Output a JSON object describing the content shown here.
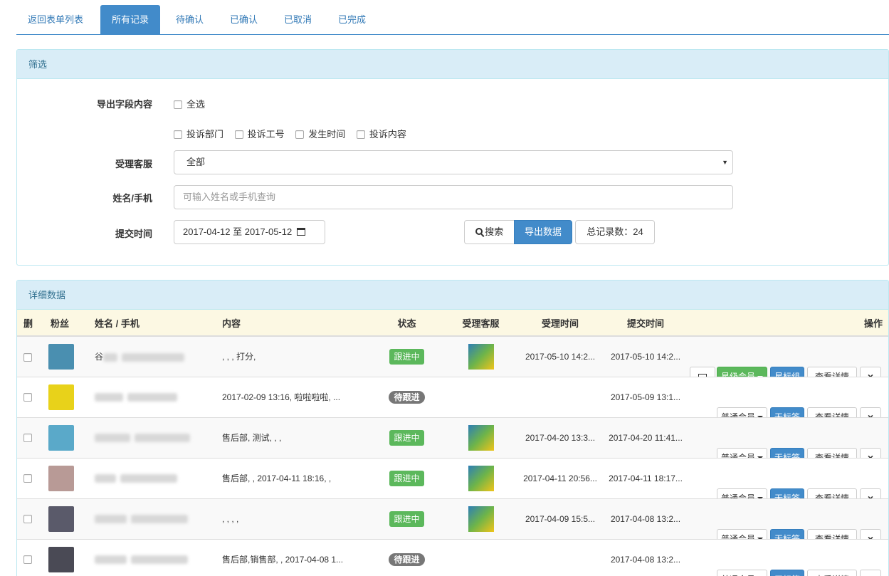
{
  "tabs": [
    "返回表单列表",
    "所有记录",
    "待确认",
    "已确认",
    "已取消",
    "已完成"
  ],
  "filter": {
    "heading": "筛选",
    "export_label": "导出字段内容",
    "select_all": "全选",
    "fields": [
      "投诉部门",
      "投诉工号",
      "发生时间",
      "投诉内容"
    ],
    "agent_label": "受理客服",
    "agent_value": "全部",
    "name_label": "姓名/手机",
    "name_placeholder": "可输入姓名或手机查询",
    "time_label": "提交时间",
    "date_range": "2017-04-12 至 2017-05-12",
    "search_btn": "搜索",
    "export_btn": "导出数据",
    "total_label": "总记录数：24"
  },
  "detail": {
    "heading": "详细数据",
    "columns": [
      "删",
      "粉丝",
      "姓名 / 手机",
      "内容",
      "状态",
      "受理客服",
      "受理时间",
      "提交时间",
      "操作"
    ],
    "rows": [
      {
        "name": "谷",
        "content": ", , , 打分,",
        "status": "跟进中",
        "status_type": "green",
        "has_agent": true,
        "accept_time": "2017-05-10 14:2...",
        "submit_time": "2017-05-10 14:2...",
        "member": "星级会员",
        "member_type": "green",
        "tag": "星标组",
        "has_image_btn": true,
        "avatar": "#4a8fb0"
      },
      {
        "name": "",
        "content": "2017-02-09 13:16, 啦啦啦啦, ...",
        "status": "待跟进",
        "status_type": "gray",
        "has_agent": false,
        "accept_time": "",
        "submit_time": "2017-05-09 13:1...",
        "member": "普通会员",
        "member_type": "default",
        "tag": "无标签",
        "has_image_btn": false,
        "avatar": "#e8d21a"
      },
      {
        "name": "",
        "content": "售后部, 测试, , ,",
        "status": "跟进中",
        "status_type": "green",
        "has_agent": true,
        "accept_time": "2017-04-20 13:3...",
        "submit_time": "2017-04-20 11:41...",
        "member": "普通会员",
        "member_type": "default",
        "tag": "无标签",
        "has_image_btn": false,
        "avatar": "#5aa9c9"
      },
      {
        "name": "",
        "content": "售后部, , 2017-04-11 18:16, ,",
        "status": "跟进中",
        "status_type": "green",
        "has_agent": true,
        "accept_time": "2017-04-11 20:56...",
        "submit_time": "2017-04-11 18:17...",
        "member": "普通会员",
        "member_type": "default",
        "tag": "无标签",
        "has_image_btn": false,
        "avatar": "#b89a96"
      },
      {
        "name": "",
        "content": ", , , ,",
        "status": "跟进中",
        "status_type": "green",
        "has_agent": true,
        "accept_time": "2017-04-09 15:5...",
        "submit_time": "2017-04-08 13:2...",
        "member": "普通会员",
        "member_type": "default",
        "tag": "无标签",
        "has_image_btn": false,
        "avatar": "#5a5a6a"
      },
      {
        "name": "",
        "content": "售后部,销售部, , 2017-04-08 1...",
        "status": "待跟进",
        "status_type": "gray",
        "has_agent": false,
        "accept_time": "",
        "submit_time": "2017-04-08 13:2...",
        "member": "普通会员",
        "member_type": "default",
        "tag": "无标签",
        "has_image_btn": false,
        "avatar": "#4a4a55"
      }
    ],
    "detail_btn": "查看详情",
    "delete_icon": "×"
  },
  "colors": {
    "primary": "#428bca",
    "success": "#5cb85c",
    "panel_bg": "#d9edf7",
    "thead_bg": "#fcf8e3"
  }
}
